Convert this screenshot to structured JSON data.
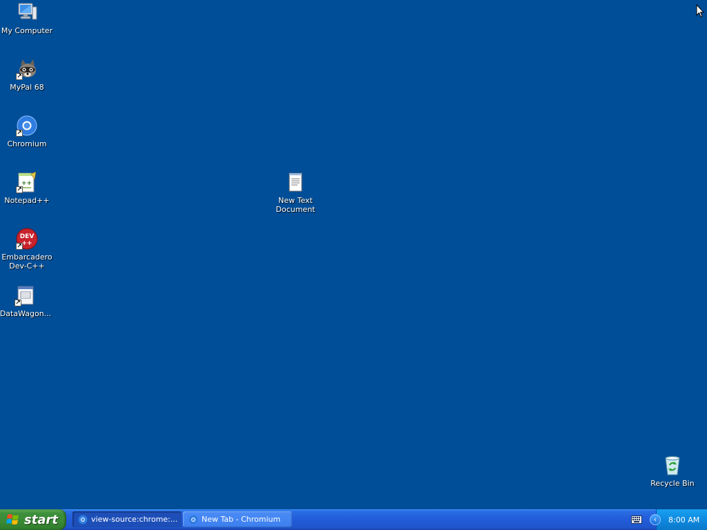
{
  "desktop": {
    "icons": [
      {
        "label": "My Computer"
      },
      {
        "label": "MyPal 68"
      },
      {
        "label": "Chromium"
      },
      {
        "label": "Notepad++"
      },
      {
        "label": "Embarcadero Dev-C++"
      },
      {
        "label": "DataWagon..."
      },
      {
        "label": "New Text Document"
      },
      {
        "label": "Recycle Bin"
      }
    ],
    "background_color": "#004e98"
  },
  "taskbar": {
    "start_label": "start",
    "tasks": [
      {
        "label": "view-source:chrome:...",
        "state": "active"
      },
      {
        "label": "New Tab - Chromium",
        "state": "inactive"
      }
    ]
  },
  "tray": {
    "time": "8:00 AM",
    "icons": [
      "keyboard-icon",
      "chevron-left-icon"
    ]
  }
}
